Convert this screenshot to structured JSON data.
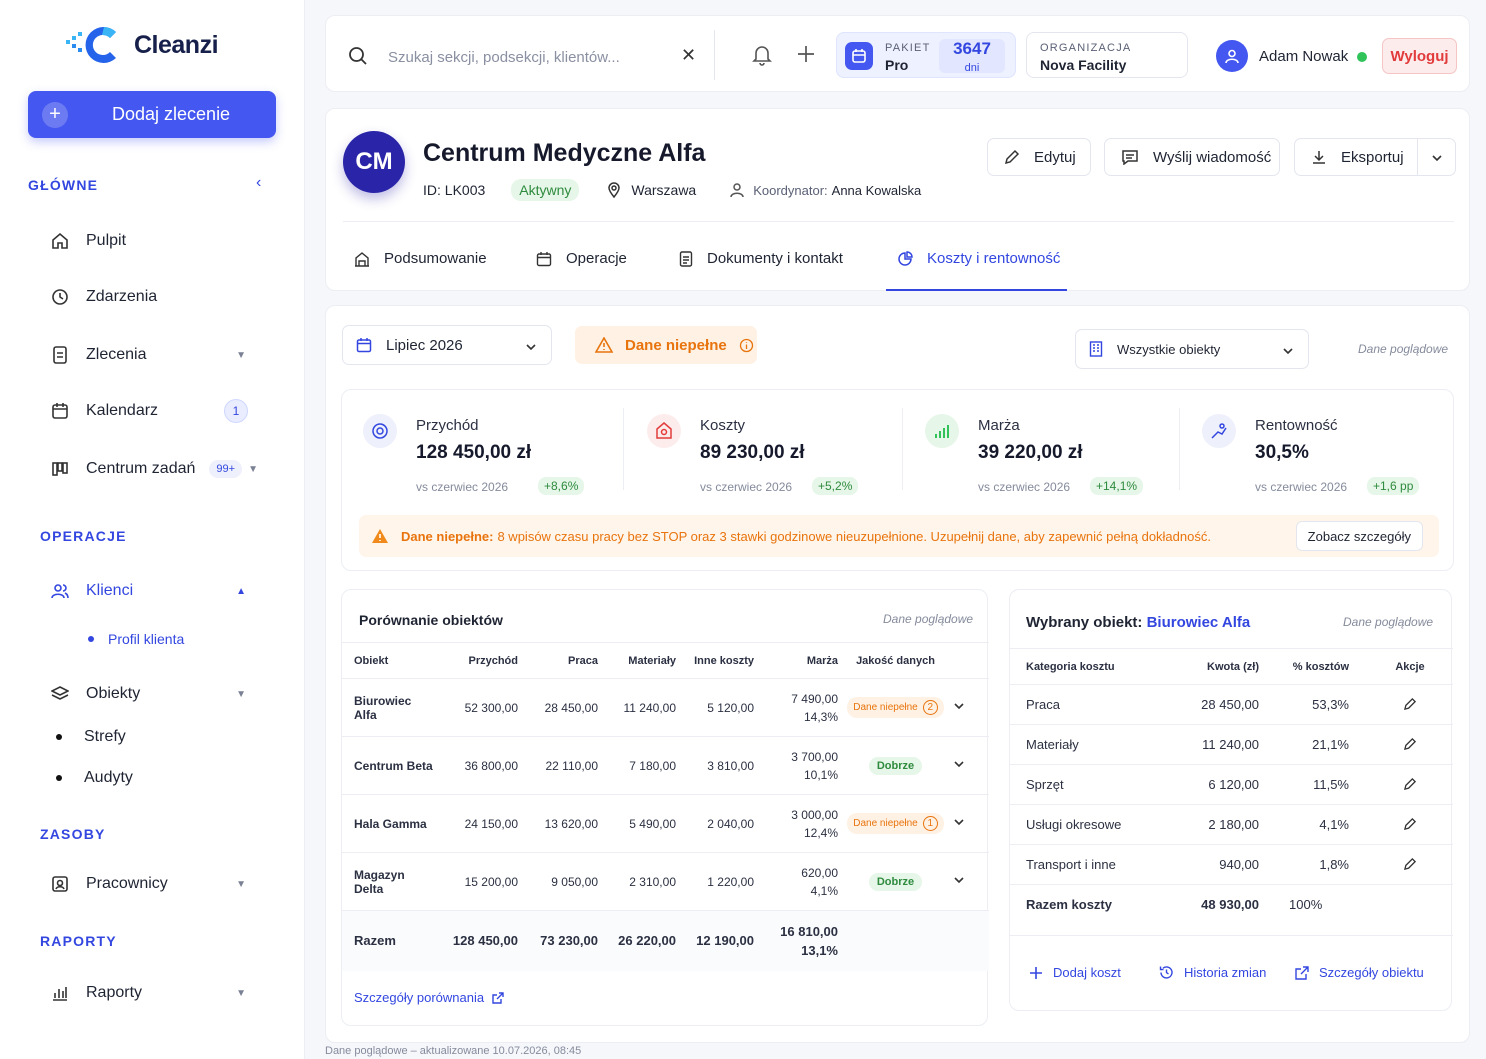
{
  "brand": {
    "name": "Cleanzi",
    "accent": "#4457f0"
  },
  "sidebar": {
    "add_button": "Dodaj zlecenie",
    "sections": {
      "main": "GŁÓWNE",
      "operations": "OPERACJE",
      "resources": "ZASOBY",
      "reports": "RAPORTY"
    },
    "items": {
      "dashboard": "Pulpit",
      "events": "Zdarzenia",
      "orders": "Zlecenia",
      "calendar": "Kalendarz",
      "calendar_badge": "1",
      "task_center": "Centrum zadań",
      "task_center_badge": "99+",
      "clients": "Klienci",
      "client_profile": "Profil klienta",
      "objects": "Obiekty",
      "zones": "Strefy",
      "audits": "Audyty",
      "employees": "Pracownicy",
      "reports": "Raporty"
    }
  },
  "topbar": {
    "search_placeholder": "Szukaj sekcji, podsekcji, klientów...",
    "package_label": "PAKIET",
    "package_value": "Pro",
    "days_value": "3647",
    "days_unit": "dni",
    "org_label": "ORGANIZACJA",
    "org_value": "Nova Facility",
    "user_name": "Adam Nowak",
    "logout": "Wyloguj"
  },
  "client": {
    "initials": "CM",
    "name": "Centrum Medyczne Alfa",
    "id": "ID: LK003",
    "status": "Aktywny",
    "city": "Warszawa",
    "coordinator_label": "Koordynator:",
    "coordinator": "Anna Kowalska",
    "actions": {
      "edit": "Edytuj",
      "message": "Wyślij wiadomość",
      "export": "Eksportuj"
    }
  },
  "tabs": [
    {
      "label": "Podsumowanie"
    },
    {
      "label": "Operacje"
    },
    {
      "label": "Dokumenty i kontakt"
    },
    {
      "label": "Koszty i rentowność"
    }
  ],
  "filters": {
    "month": "Lipiec 2026",
    "incomplete": "Dane niepełne",
    "objects": "Wszystkie obiekty",
    "preview": "Dane poglądowe"
  },
  "kpis": [
    {
      "label": "Przychód",
      "value": "128 450,00 zł",
      "vs": "vs czerwiec 2026",
      "change": "+8,6%"
    },
    {
      "label": "Koszty",
      "value": "89 230,00 zł",
      "vs": "vs czerwiec 2026",
      "change": "+5,2%"
    },
    {
      "label": "Marża",
      "value": "39 220,00 zł",
      "vs": "vs czerwiec 2026",
      "change": "+14,1%"
    },
    {
      "label": "Rentowność",
      "value": "30,5%",
      "vs": "vs czerwiec 2026",
      "change": "+1,6 pp"
    }
  ],
  "alert": {
    "title": "Dane niepełne:",
    "message": "8 wpisów czasu pracy bez STOP oraz 3 stawki godzinowe nieuzupełnione. Uzupełnij dane, aby zapewnić pełną dokładność.",
    "button": "Zobacz szczegóły"
  },
  "comparison": {
    "title": "Porównanie obiektów",
    "preview": "Dane poglądowe",
    "headers": [
      "Obiekt",
      "Przychód",
      "Praca",
      "Materiały",
      "Inne koszty",
      "Marża",
      "Jakość danych"
    ],
    "rows": [
      {
        "name": "Biurowiec Alfa",
        "rev": "52 300,00",
        "work": "28 450,00",
        "mat": "11 240,00",
        "other": "5 120,00",
        "margin": "7 490,00",
        "pct": "14,3%",
        "quality": "Dane niepełne",
        "qcount": "2"
      },
      {
        "name": "Centrum Beta",
        "rev": "36 800,00",
        "work": "22 110,00",
        "mat": "7 180,00",
        "other": "3 810,00",
        "margin": "3 700,00",
        "pct": "10,1%",
        "quality": "Dobrze",
        "qcount": ""
      },
      {
        "name": "Hala Gamma",
        "rev": "24 150,00",
        "work": "13 620,00",
        "mat": "5 490,00",
        "other": "2 040,00",
        "margin": "3 000,00",
        "pct": "12,4%",
        "quality": "Dane niepełne",
        "qcount": "1"
      },
      {
        "name": "Magazyn Delta",
        "rev": "15 200,00",
        "work": "9 050,00",
        "mat": "2 310,00",
        "other": "1 220,00",
        "margin": "620,00",
        "pct": "4,1%",
        "quality": "Dobrze",
        "qcount": ""
      }
    ],
    "total": {
      "name": "Razem",
      "rev": "128 450,00",
      "work": "73 230,00",
      "mat": "26 220,00",
      "other": "12 190,00",
      "margin": "16 810,00",
      "pct": "13,1%"
    },
    "link": "Szczegóły porównania"
  },
  "detail": {
    "title": "Wybrany obiekt:",
    "object": "Biurowiec Alfa",
    "preview": "Dane poglądowe",
    "headers": [
      "Kategoria kosztu",
      "Kwota (zł)",
      "% kosztów",
      "Akcje"
    ],
    "rows": [
      {
        "cat": "Praca",
        "amount": "28 450,00",
        "pct": "53,3%"
      },
      {
        "cat": "Materiały",
        "amount": "11 240,00",
        "pct": "21,1%"
      },
      {
        "cat": "Sprzęt",
        "amount": "6 120,00",
        "pct": "11,5%"
      },
      {
        "cat": "Usługi okresowe",
        "amount": "2 180,00",
        "pct": "4,1%"
      },
      {
        "cat": "Transport i inne",
        "amount": "940,00",
        "pct": "1,8%"
      }
    ],
    "total": {
      "cat": "Razem koszty",
      "amount": "48 930,00",
      "pct": "100%"
    },
    "actions": {
      "add": "Dodaj koszt",
      "history": "Historia zmian",
      "details": "Szczegóły obiektu"
    }
  },
  "footer": "Dane poglądowe – aktualizowane 10.07.2026, 08:45"
}
